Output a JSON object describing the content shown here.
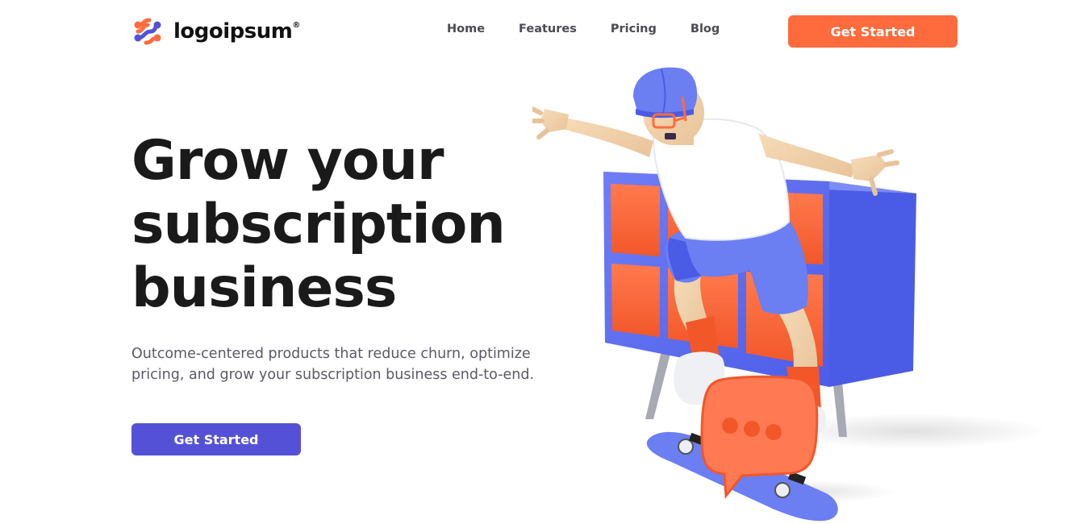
{
  "brand": {
    "name": "logoipsum",
    "mark": "®"
  },
  "nav": {
    "items": [
      {
        "label": "Home"
      },
      {
        "label": "Features"
      },
      {
        "label": "Pricing"
      },
      {
        "label": "Blog"
      }
    ]
  },
  "header_cta": {
    "label": "Get Started"
  },
  "hero": {
    "title": "Grow your subscription business",
    "subtitle": "Outcome-centered products that reduce churn, optimize pricing, and grow your subscription business end-to-end.",
    "cta_label": "Get Started"
  },
  "colors": {
    "accent_orange": "#ff6b3d",
    "accent_purple": "#5551d6",
    "text_dark": "#1a1a1a",
    "text_muted": "#5a5a66"
  },
  "illustration": {
    "icon": "skateboarder-illustration",
    "chat_bubble_icon": "chat-bubble-icon"
  }
}
